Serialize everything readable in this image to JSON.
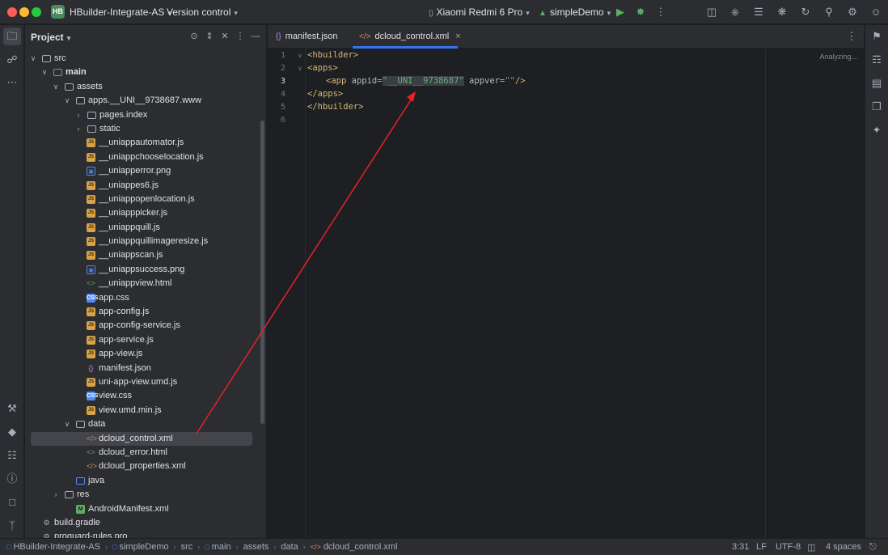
{
  "titlebar": {
    "project_badge": "HB",
    "project_name": "HBuilder-Integrate-AS",
    "vcs": "Version control",
    "device": "Xiaomi Redmi 6 Pro",
    "run_config": "simpleDemo"
  },
  "project_panel": {
    "title": "Project",
    "tree": [
      {
        "label": "src",
        "icon": "folder",
        "arrow": "open",
        "indent": 0
      },
      {
        "label": "main",
        "icon": "folder-green",
        "arrow": "open",
        "indent": 1,
        "bold": true
      },
      {
        "label": "assets",
        "icon": "folder",
        "arrow": "open",
        "indent": 2
      },
      {
        "label": "apps.__UNI__9738687.www",
        "icon": "folder",
        "arrow": "open",
        "indent": 3
      },
      {
        "label": "pages.index",
        "icon": "folder",
        "arrow": "closed",
        "indent": 4
      },
      {
        "label": "static",
        "icon": "folder",
        "arrow": "closed",
        "indent": 4
      },
      {
        "label": "__uniappautomator.js",
        "icon": "js",
        "indent": 5
      },
      {
        "label": "__uniappchooselocation.js",
        "icon": "js",
        "indent": 5
      },
      {
        "label": "__uniapperror.png",
        "icon": "png",
        "indent": 5
      },
      {
        "label": "__uniappes6.js",
        "icon": "js",
        "indent": 5
      },
      {
        "label": "__uniappopenlocation.js",
        "icon": "js",
        "indent": 5
      },
      {
        "label": "__uniapppicker.js",
        "icon": "js",
        "indent": 5
      },
      {
        "label": "__uniappquill.js",
        "icon": "js",
        "indent": 5
      },
      {
        "label": "__uniappquillimageresize.js",
        "icon": "js",
        "indent": 5
      },
      {
        "label": "__uniappscan.js",
        "icon": "js",
        "indent": 5
      },
      {
        "label": "__uniappsuccess.png",
        "icon": "png",
        "indent": 5
      },
      {
        "label": "__uniappview.html",
        "icon": "html",
        "indent": 5
      },
      {
        "label": "app.css",
        "icon": "css",
        "indent": 5
      },
      {
        "label": "app-config.js",
        "icon": "js",
        "indent": 5
      },
      {
        "label": "app-config-service.js",
        "icon": "js",
        "indent": 5
      },
      {
        "label": "app-service.js",
        "icon": "js",
        "indent": 5
      },
      {
        "label": "app-view.js",
        "icon": "js",
        "indent": 5
      },
      {
        "label": "manifest.json",
        "icon": "json",
        "indent": 5
      },
      {
        "label": "uni-app-view.umd.js",
        "icon": "js",
        "indent": 5
      },
      {
        "label": "view.css",
        "icon": "css",
        "indent": 5
      },
      {
        "label": "view.umd.min.js",
        "icon": "js",
        "indent": 5
      },
      {
        "label": "data",
        "icon": "folder",
        "arrow": "open",
        "indent": 3
      },
      {
        "label": "dcloud_control.xml",
        "icon": "xml",
        "indent": 5,
        "selected": true
      },
      {
        "label": "dcloud_error.html",
        "icon": "html",
        "indent": 5
      },
      {
        "label": "dcloud_properties.xml",
        "icon": "xml",
        "indent": 5
      },
      {
        "label": "java",
        "icon": "folder-blue",
        "indent": 3
      },
      {
        "label": "res",
        "icon": "folder",
        "arrow": "closed",
        "indent": 2
      },
      {
        "label": "AndroidManifest.xml",
        "icon": "manifest",
        "indent": 3
      },
      {
        "label": "build.gradle",
        "icon": "gradle",
        "indent": 0
      },
      {
        "label": "proguard-rules.pro",
        "icon": "gradle",
        "indent": 0
      }
    ]
  },
  "tabs": [
    {
      "label": "manifest.json",
      "icon": "{}",
      "active": false
    },
    {
      "label": "dcloud_control.xml",
      "icon": "</>",
      "active": true
    }
  ],
  "editor": {
    "status": "Analyzing...",
    "line_numbers": [
      "1",
      "2",
      "3",
      "4",
      "5",
      "6"
    ],
    "current_line": "3",
    "lines": {
      "l1_tag": "<hbuilder>",
      "l2_tag": "<apps>",
      "l3_open": "<app",
      "l3_attr1": "appid=",
      "l3_val1": "\"__UNI__9738687\"",
      "l3_attr2": "appver=",
      "l3_val2": "\"\"",
      "l3_close": "/>",
      "l4_tag": "</apps>",
      "l5_tag": "</hbuilder>"
    }
  },
  "statusbar": {
    "breadcrumbs": [
      "HBuilder-Integrate-AS",
      "simpleDemo",
      "src",
      "main",
      "assets",
      "data",
      "dcloud_control.xml"
    ],
    "position": "3:31",
    "line_ending": "LF",
    "encoding": "UTF-8",
    "indent": "4 spaces"
  },
  "colors": {
    "annotation_arrow": "#e8202a",
    "accent": "#3574f0"
  }
}
